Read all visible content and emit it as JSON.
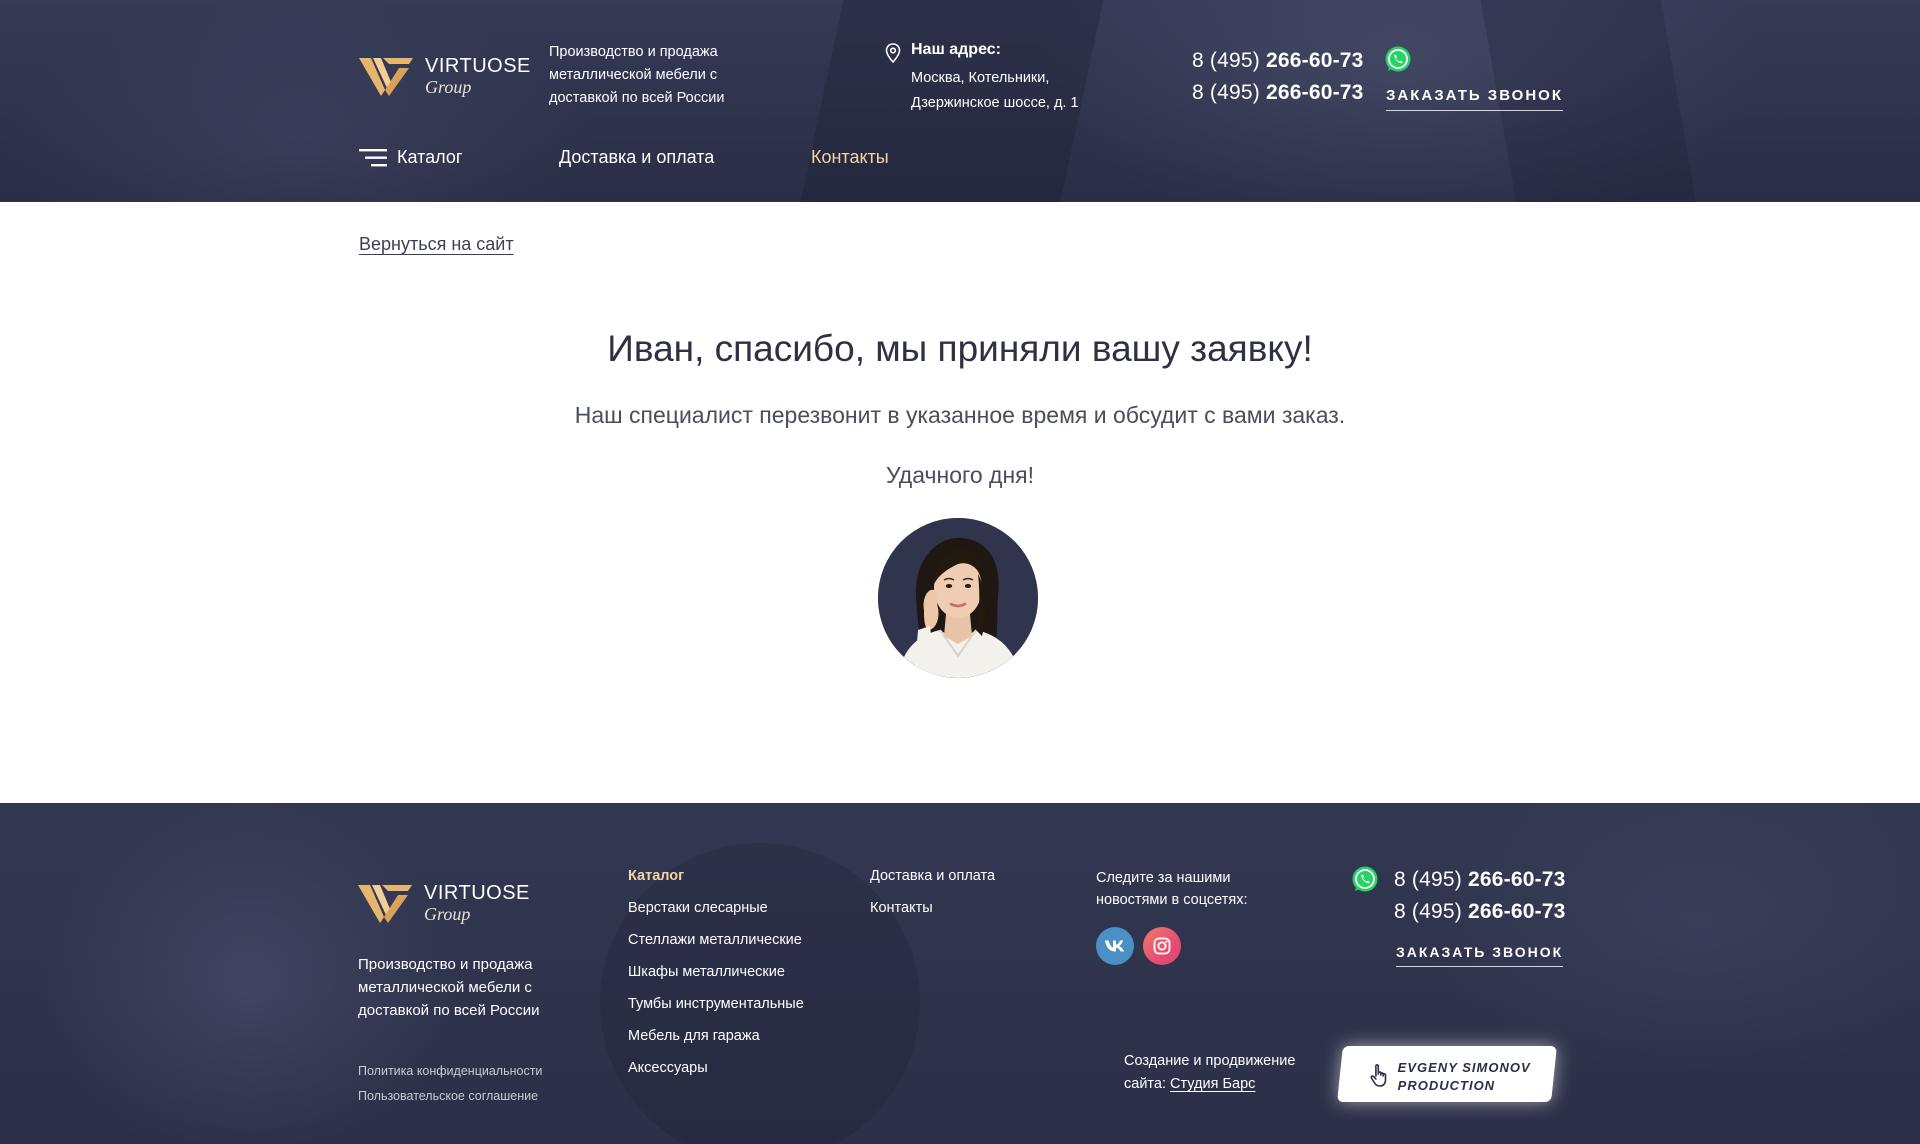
{
  "header": {
    "logo": {
      "line1": "VIRTUOSE",
      "line2": "Group"
    },
    "tagline": "Производство и продажа металлической мебели с доставкой по всей России",
    "address": {
      "label": "Наш адрес:",
      "line1": "Москва, Котельники,",
      "line2": "Дзержинское шоссе, д. 1"
    },
    "phones": [
      {
        "prefix": "8 (495) ",
        "number": "266-60-73"
      },
      {
        "prefix": "8 (495) ",
        "number": "266-60-73"
      }
    ],
    "callback_label": "ЗАКАЗАТЬ ЗВОНОК",
    "nav": {
      "catalog": "Каталог",
      "delivery": "Доставка и оплата",
      "contacts": "Контакты"
    }
  },
  "main": {
    "back_link": "Вернуться на сайт",
    "title": "Иван, спасибо, мы приняли вашу заявку!",
    "subtitle": "Наш специалист перезвонит в указанное время и обсудит с вами заказ.",
    "wish": "Удачного дня!"
  },
  "footer": {
    "logo": {
      "line1": "VIRTUOSE",
      "line2": "Group"
    },
    "tagline": "Производство и продажа металлической мебели с доставкой по всей России",
    "legal": [
      "Политика конфиденциальности",
      "Пользовательское соглашение"
    ],
    "catalog": {
      "title": "Каталог",
      "items": [
        "Верстаки слесарные",
        "Стеллажи металлические",
        "Шкафы металлические",
        "Тумбы инструментальные",
        "Мебель для гаража",
        "Аксессуары"
      ]
    },
    "links": [
      "Доставка и оплата",
      "Контакты"
    ],
    "social_text": "Следите за нашими новостями в соцсетях:",
    "phones": [
      {
        "prefix": "8 (495) ",
        "number": "266-60-73"
      },
      {
        "prefix": "8 (495) ",
        "number": "266-60-73"
      }
    ],
    "callback_label": "ЗАКАЗАТЬ ЗВОНОК",
    "credit": {
      "text": "Создание и продвижение сайта: ",
      "studio": "Студия Барс"
    },
    "developer": {
      "line1": "EVGENY SIMONOV",
      "line2": "PRODUCTION"
    }
  },
  "colors": {
    "header_bg": "#2f3450",
    "accent_gold": "#f3d4a4",
    "whatsapp": "#25d366",
    "vk": "#4a90c4",
    "instagram": "#e54f72"
  },
  "icons": [
    "logo-mark",
    "location-pin-icon",
    "whatsapp-icon",
    "menu-burger-icon",
    "vk-icon",
    "instagram-icon",
    "pointer-hand-icon"
  ]
}
